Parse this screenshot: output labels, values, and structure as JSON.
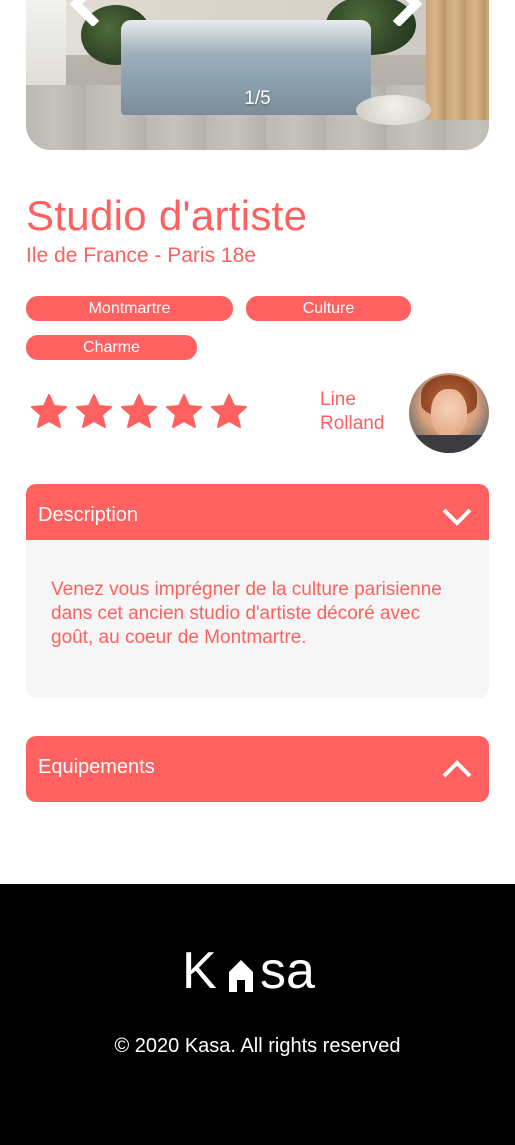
{
  "gallery": {
    "counter": "1/5",
    "prev_icon": "chevron-left-icon",
    "next_icon": "chevron-right-icon"
  },
  "listing": {
    "title": "Studio d'artiste",
    "location": "Ile de France - Paris 18e",
    "tags": [
      "Montmartre",
      "Culture",
      "Charme"
    ],
    "rating": 5,
    "rating_max": 5
  },
  "host": {
    "name": "Line Rolland"
  },
  "description": {
    "label": "Description",
    "text": "Venez vous imprégner de la culture parisienne dans cet ancien studio d'artiste décoré avec goût, au coeur de Montmartre."
  },
  "equipements": {
    "label": "Equipements"
  },
  "footer": {
    "logo_text": "Kasa",
    "copyright": "© 2020 Kasa. All rights reserved"
  },
  "colors": {
    "accent": "#ff6060",
    "panel_bg": "#f6f6f6",
    "footer_bg": "#000000"
  }
}
